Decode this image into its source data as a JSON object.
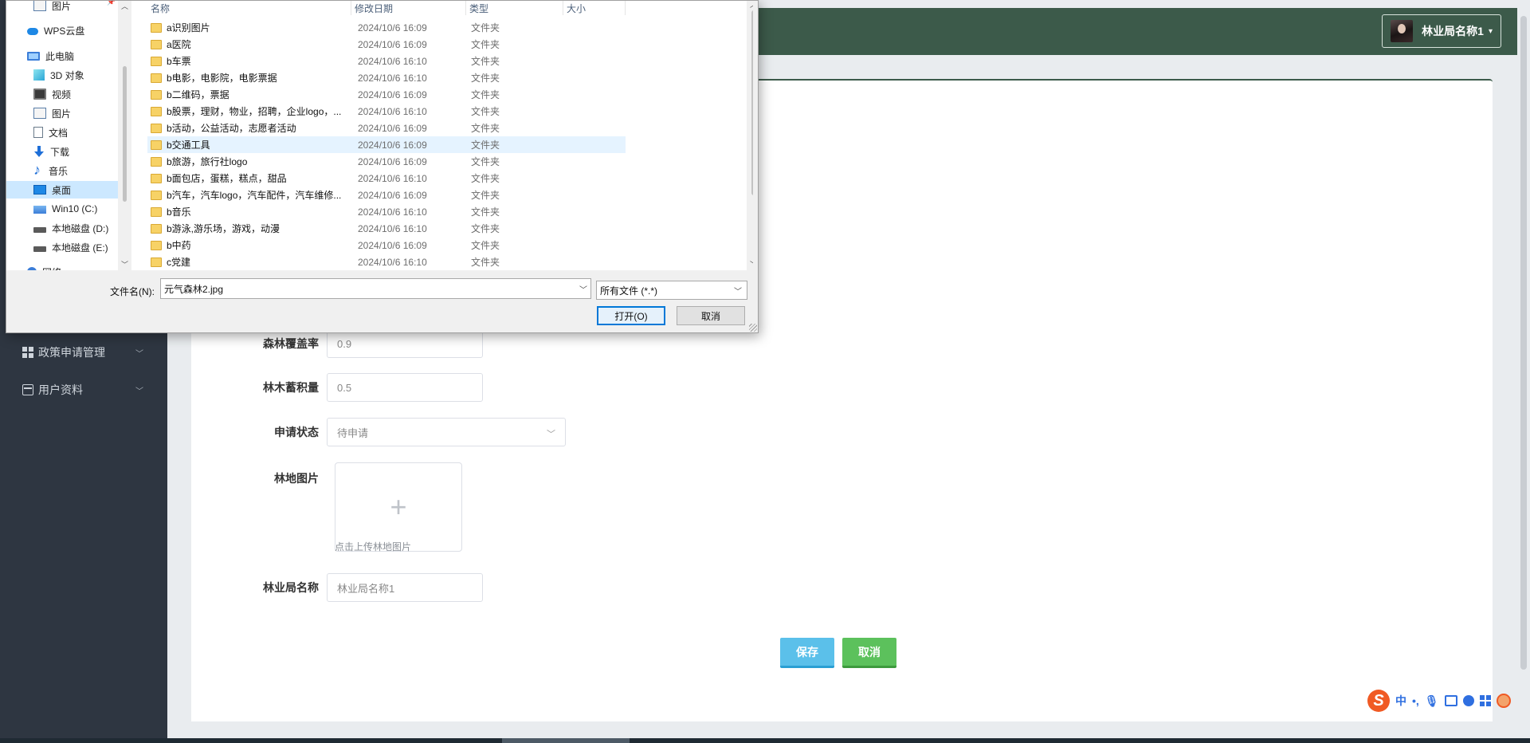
{
  "header": {
    "user_name": "林业局名称1"
  },
  "sidebar": {
    "items": [
      {
        "label": "政策申请管理",
        "icon": "grid-icon"
      },
      {
        "label": "用户资料",
        "icon": "id-card-icon"
      }
    ]
  },
  "form": {
    "fields": {
      "forest_coverage": {
        "label": "森林覆盖率",
        "value": "0.9"
      },
      "timber_volume": {
        "label": "林木蓄积量",
        "value": "0.5"
      },
      "status": {
        "label": "申请状态",
        "value": "待申请"
      },
      "land_image": {
        "label": "林地图片",
        "tip": "点击上传林地图片"
      },
      "bureau_name": {
        "label": "林业局名称",
        "value": "林业局名称1"
      }
    },
    "save_label": "保存",
    "cancel_label": "取消"
  },
  "dialog": {
    "nav": {
      "pinned_pictures": "图片",
      "wps_cloud": "WPS云盘",
      "this_pc": "此电脑",
      "objects_3d": "3D 对象",
      "videos": "视频",
      "pictures": "图片",
      "documents": "文档",
      "downloads": "下载",
      "music": "音乐",
      "desktop": "桌面",
      "drive_c": "Win10 (C:)",
      "drive_d": "本地磁盘 (D:)",
      "drive_e": "本地磁盘 (E:)",
      "network": "网络"
    },
    "columns": {
      "name": "名称",
      "modified": "修改日期",
      "type": "类型",
      "size": "大小"
    },
    "files": [
      {
        "name": "a识别图片",
        "date": "2024/10/6 16:09",
        "type": "文件夹"
      },
      {
        "name": "a医院",
        "date": "2024/10/6 16:09",
        "type": "文件夹"
      },
      {
        "name": "b车票",
        "date": "2024/10/6 16:10",
        "type": "文件夹"
      },
      {
        "name": "b电影，电影院，电影票据",
        "date": "2024/10/6 16:10",
        "type": "文件夹"
      },
      {
        "name": "b二维码，票据",
        "date": "2024/10/6 16:09",
        "type": "文件夹"
      },
      {
        "name": "b股票，理财，物业，招聘，企业logo，...",
        "date": "2024/10/6 16:10",
        "type": "文件夹"
      },
      {
        "name": "b活动，公益活动，志愿者活动",
        "date": "2024/10/6 16:09",
        "type": "文件夹"
      },
      {
        "name": "b交通工具",
        "date": "2024/10/6 16:09",
        "type": "文件夹"
      },
      {
        "name": "b旅游，旅行社logo",
        "date": "2024/10/6 16:09",
        "type": "文件夹"
      },
      {
        "name": "b面包店，蛋糕，糕点，甜品",
        "date": "2024/10/6 16:10",
        "type": "文件夹"
      },
      {
        "name": "b汽车，汽车logo，汽车配件，汽车维修...",
        "date": "2024/10/6 16:09",
        "type": "文件夹"
      },
      {
        "name": "b音乐",
        "date": "2024/10/6 16:10",
        "type": "文件夹"
      },
      {
        "name": "b游泳,游乐场，游戏，动漫",
        "date": "2024/10/6 16:10",
        "type": "文件夹"
      },
      {
        "name": "b中药",
        "date": "2024/10/6 16:09",
        "type": "文件夹"
      },
      {
        "name": "c党建",
        "date": "2024/10/6 16:10",
        "type": "文件夹"
      }
    ],
    "highlighted_row": 7,
    "filename_label": "文件名(N):",
    "filename_value": "元气森林2.jpg",
    "filetype_value": "所有文件 (*.*)",
    "open_label": "打开(O)",
    "cancel_label": "取消"
  },
  "ime": {
    "lang": "中",
    "punct": "•,"
  },
  "colors": {
    "header_bg": "#3c5a4a",
    "sidebar_bg": "#2e3641",
    "save_btn": "#5bc0ea",
    "cancel_btn": "#5cc15c",
    "selection": "#cce8ff"
  }
}
